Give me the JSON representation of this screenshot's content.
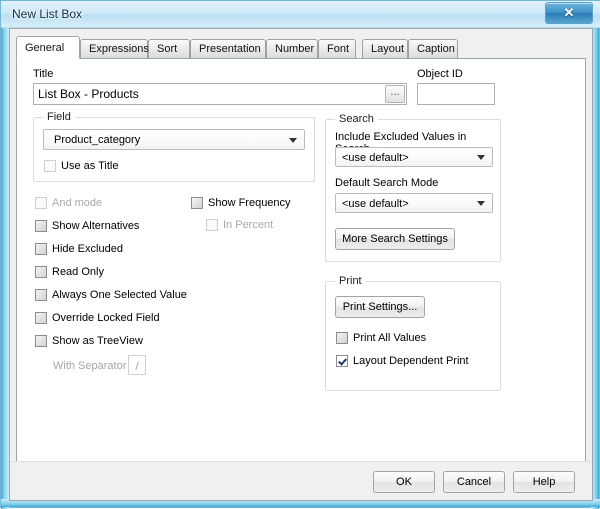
{
  "window": {
    "title": "New List Box",
    "close_icon": "close-icon",
    "close_glyph": "✕"
  },
  "tabs": [
    {
      "label": "General",
      "active": true
    },
    {
      "label": "Expressions",
      "active": false
    },
    {
      "label": "Sort",
      "active": false
    },
    {
      "label": "Presentation",
      "active": false
    },
    {
      "label": "Number",
      "active": false
    },
    {
      "label": "Font",
      "active": false
    },
    {
      "label": "Layout",
      "active": false
    },
    {
      "label": "Caption",
      "active": false
    }
  ],
  "general": {
    "title_label": "Title",
    "title_value": "List Box - Products",
    "title_browse_label": "...",
    "object_id_label": "Object ID",
    "object_id_value": "",
    "object_id_placeholder": "",
    "field_group": {
      "title": "Field",
      "selected_field": "Product_category",
      "use_as_title": {
        "label": "Use as Title",
        "checked": false,
        "enabled": false
      }
    },
    "checkboxes_left": [
      {
        "label": "And mode",
        "checked": false,
        "enabled": false
      },
      {
        "label": "Show Alternatives",
        "checked": false,
        "enabled": true
      },
      {
        "label": "Hide Excluded",
        "checked": false,
        "enabled": true
      },
      {
        "label": "Read Only",
        "checked": false,
        "enabled": true
      },
      {
        "label": "Always One Selected Value",
        "checked": false,
        "enabled": true
      },
      {
        "label": "Override Locked Field",
        "checked": false,
        "enabled": true
      },
      {
        "label": "Show as TreeView",
        "checked": false,
        "enabled": true
      }
    ],
    "checkboxes_right": [
      {
        "label": "Show Frequency",
        "checked": false,
        "enabled": true
      },
      {
        "label": "In Percent",
        "checked": false,
        "enabled": false
      }
    ],
    "separator": {
      "label": "With Separator",
      "value": "/",
      "enabled": false
    },
    "search_group": {
      "title": "Search",
      "include_excluded_label": "Include Excluded Values in Search",
      "include_excluded_value": "<use default>",
      "default_search_mode_label": "Default Search Mode",
      "default_search_mode_value": "<use default>",
      "more_search_settings_label": "More Search Settings"
    },
    "print_group": {
      "title": "Print",
      "print_settings_label": "Print Settings...",
      "print_all_values": {
        "label": "Print All Values",
        "checked": false,
        "enabled": true
      },
      "layout_dependent_print": {
        "label": "Layout Dependent Print",
        "checked": true,
        "enabled": true
      }
    }
  },
  "footer": {
    "ok_label": "OK",
    "cancel_label": "Cancel",
    "help_label": "Help"
  },
  "colors": {
    "titlebar_accent": "#b9def3",
    "window_border": "#73b8d8",
    "client_bg": "#f0f0f0",
    "page_bg": "#ffffff",
    "group_border": "#dcdcdc",
    "check_mark": "#1f3b6e",
    "disabled_text": "#a8a8a8"
  }
}
